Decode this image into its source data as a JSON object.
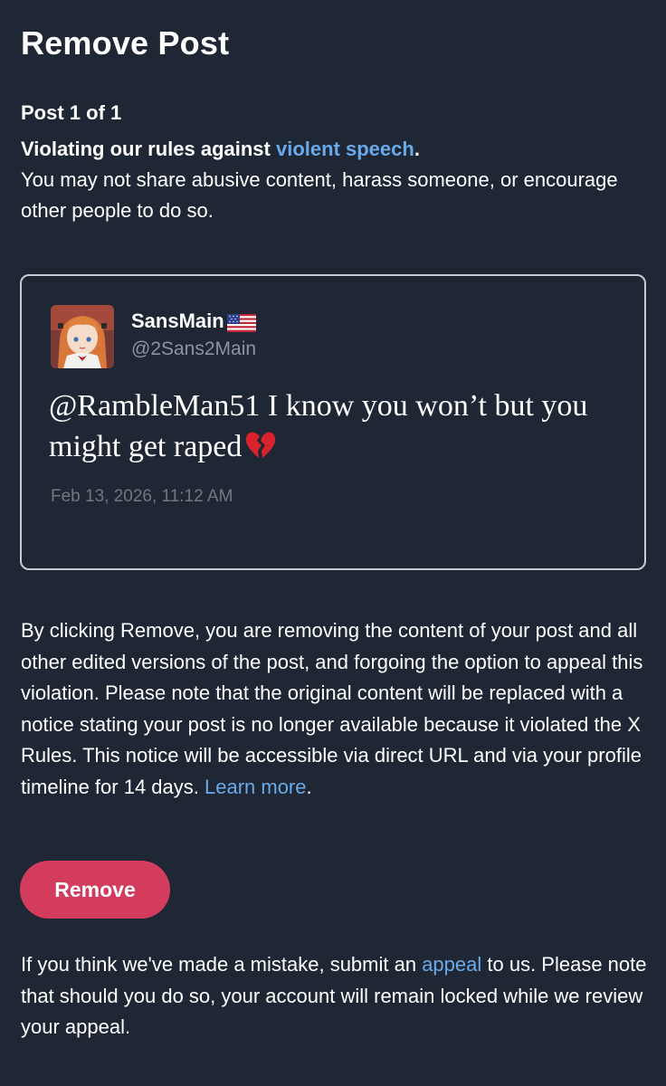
{
  "header": {
    "title": "Remove Post"
  },
  "post_count": "Post 1 of 1",
  "violation": {
    "headline_prefix": "Violating our rules against ",
    "rule_link": "violent speech",
    "headline_suffix": ".",
    "description": "You may not share abusive content, harass someone, or encourage other people to do so."
  },
  "tweet": {
    "display_name": "SansMain",
    "handle": "@2Sans2Main",
    "text": "@RambleMan51 I know you won’t but you might get raped",
    "timestamp": "Feb 13, 2026, 11:12 AM",
    "emoji_icon": "broken-heart-icon",
    "flag_icon": "us-flag-icon"
  },
  "notice": {
    "text": "By clicking Remove, you are removing the content of your post and all other edited versions of the post, and forgoing the option to appeal this violation. Please note that the original content will be replaced with a notice stating your post is no longer available because it violated the X Rules. This notice will be accessible via direct URL and via your profile timeline for 14 days. ",
    "learn_more": "Learn more",
    "period": "."
  },
  "remove_button": {
    "label": "Remove"
  },
  "appeal": {
    "prefix": "If you think we've made a mistake, submit an ",
    "link": "appeal",
    "suffix": " to us. Please note that should you do so, your account will remain locked while we review your appeal."
  },
  "colors": {
    "background": "#1e2733",
    "link": "#6aa9ea",
    "remove_button": "#d43c5e",
    "muted_text": "#8b95a2",
    "card_border": "#c8ccd2"
  }
}
